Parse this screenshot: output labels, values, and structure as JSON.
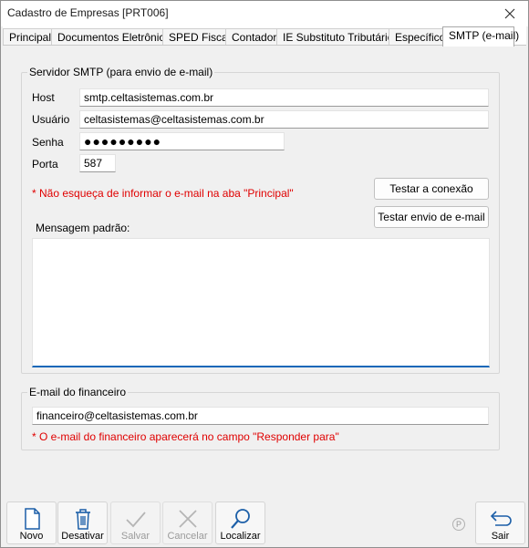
{
  "window": {
    "title": "Cadastro de Empresas [PRT006]",
    "close_icon": "close-icon"
  },
  "tabs": [
    {
      "label": "Principal",
      "active": false
    },
    {
      "label": "Documentos Eletrônicos",
      "active": false
    },
    {
      "label": "SPED Fiscal",
      "active": false
    },
    {
      "label": "Contador",
      "active": false
    },
    {
      "label": "IE Substituto Tributário",
      "active": false
    },
    {
      "label": "Específico",
      "active": false
    },
    {
      "label": "SMTP (e-mail)",
      "active": true
    }
  ],
  "smtp": {
    "group_title": "Servidor SMTP (para envio de e-mail)",
    "host_label": "Host",
    "host_value": "smtp.celtasistemas.com.br",
    "user_label": "Usuário",
    "user_value": "celtasistemas@celtasistemas.com.br",
    "password_label": "Senha",
    "password_value": "●●●●●●●●●",
    "port_label": "Porta",
    "port_value": "587",
    "warning": "* Não esqueça de informar o e-mail na aba \"Principal\"",
    "test_connection_button": "Testar a conexão",
    "test_email_button": "Testar envio de e-mail",
    "message_label": "Mensagem padrão:",
    "message_value": ""
  },
  "finance": {
    "group_title": "E-mail do financeiro",
    "email_value": "financeiro@celtasistemas.com.br",
    "note": "* O e-mail do financeiro aparecerá no campo \"Responder para\""
  },
  "toolbar": {
    "new_label": "Novo",
    "disable_label": "Desativar",
    "save_label": "Salvar",
    "cancel_label": "Cancelar",
    "find_label": "Localizar",
    "exit_label": "Sair",
    "p_mark": "P"
  },
  "colors": {
    "warning": "#e00000",
    "memo_focus": "#1467b8",
    "icon_blue": "#1c5fa8",
    "disabled": "#9a9a9a"
  }
}
